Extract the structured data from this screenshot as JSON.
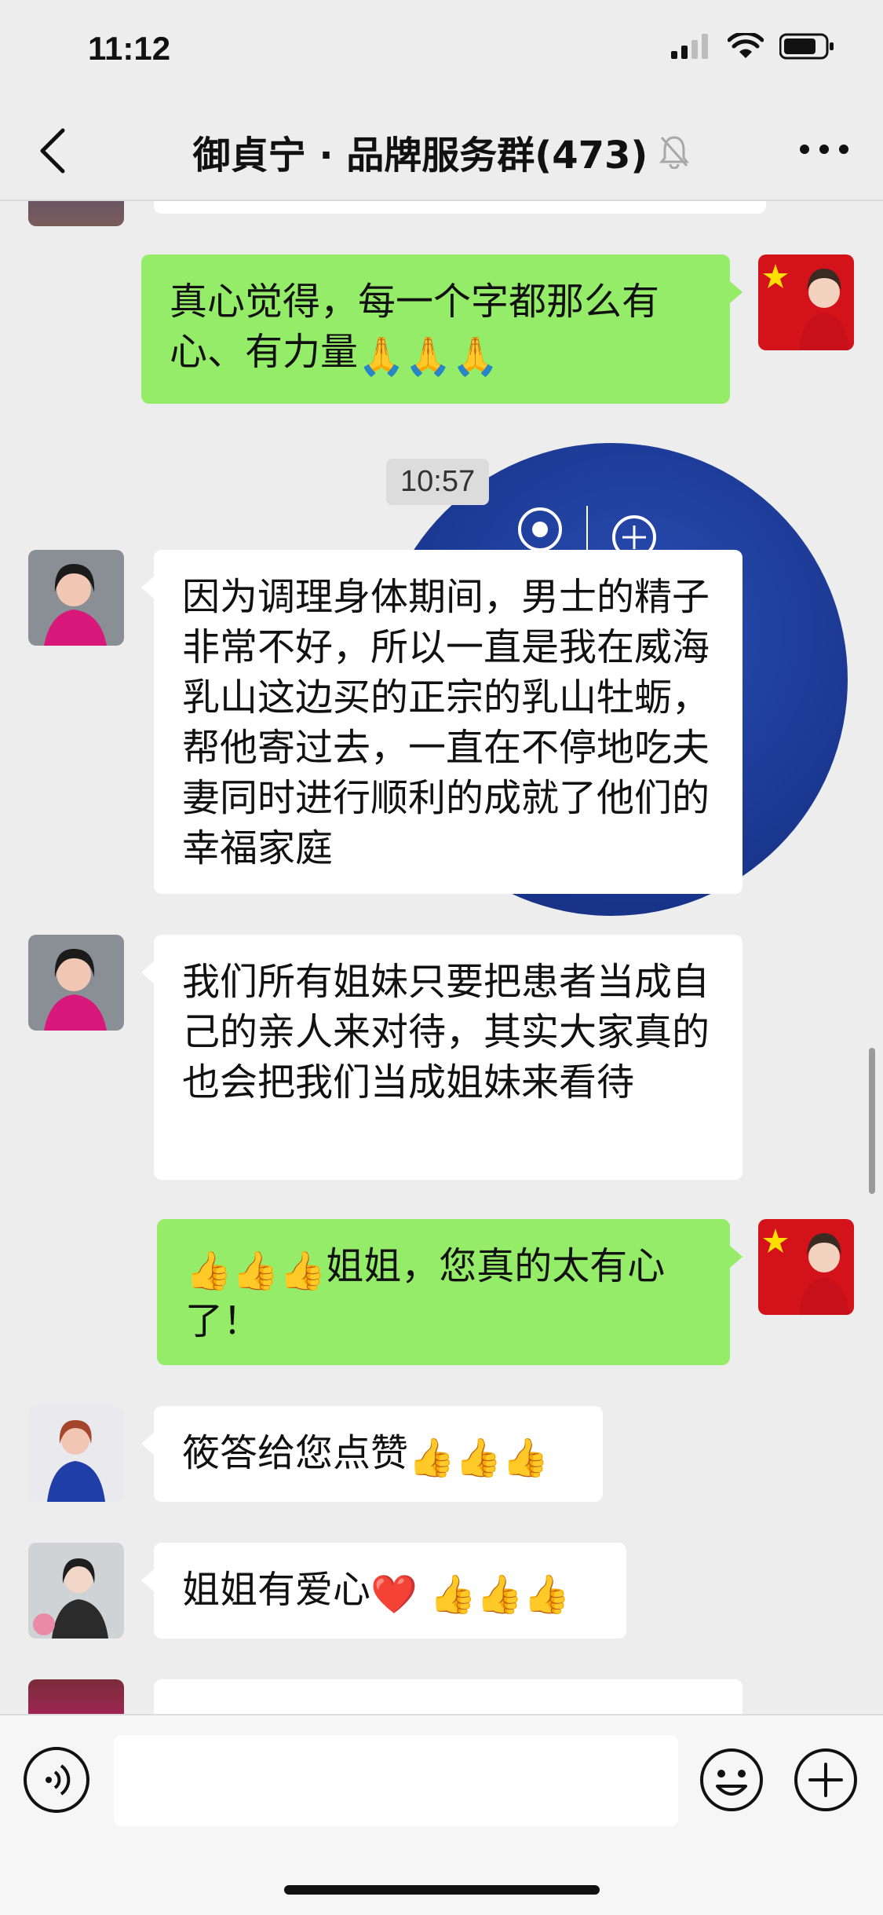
{
  "status_bar": {
    "time": "11:12"
  },
  "nav": {
    "title": "御貞宁 · 品牌服务群(473)"
  },
  "timestamp": "10:57",
  "messages": [
    {
      "id": "m1",
      "side": "right",
      "text": "真心觉得，每一个字都那么有心、有力量",
      "emoji": "🙏🙏🙏"
    },
    {
      "id": "m2",
      "side": "left",
      "text": "因为调理身体期间，男士的精子非常不好，所以一直是我在威海乳山这边买的正宗的乳山牡蛎，帮他寄过去，一直在不停地吃夫妻同时进行顺利的成就了他们的幸福家庭"
    },
    {
      "id": "m3",
      "side": "left",
      "text": "我们所有姐妹只要把患者当成自己的亲人来对待，其实大家真的也会把我们当成姐妹来看待"
    },
    {
      "id": "m4",
      "side": "right",
      "emoji": "👍👍👍",
      "text": "姐姐，您真的太有心了！"
    },
    {
      "id": "m5",
      "side": "left",
      "text": "筱答给您点赞",
      "emoji": "👍👍👍"
    },
    {
      "id": "m6",
      "side": "left",
      "text": "姐姐有爱心",
      "emoji": "❤️ 👍👍👍"
    }
  ],
  "colors": {
    "green_bubble": "#95ec69",
    "background": "#ededed"
  },
  "icons": [
    "back-icon",
    "mute-bell-icon",
    "more-icon",
    "voice-icon",
    "emoji-icon",
    "plus-icon"
  ]
}
